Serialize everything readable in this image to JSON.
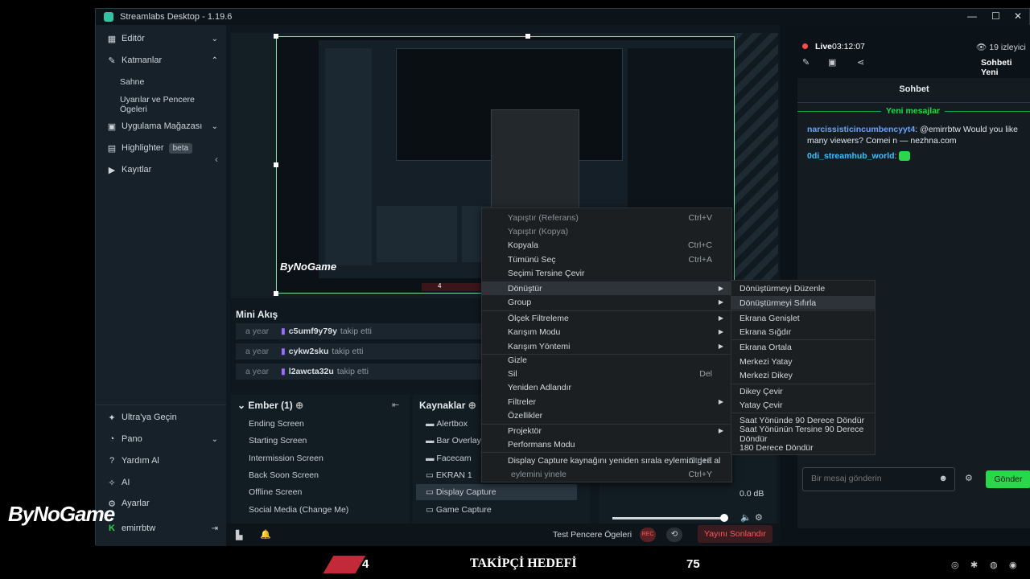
{
  "app": {
    "title": "Streamlabs Desktop - 1.19.6"
  },
  "sidebar": {
    "items": [
      {
        "label": "Editör"
      },
      {
        "label": "Katmanlar"
      },
      {
        "label": "Uygulama Mağazası"
      },
      {
        "label": "Highlighter",
        "badge": "beta"
      },
      {
        "label": "Kayıtlar"
      }
    ],
    "sub": [
      "Sahne",
      "Uyarılar ve Pencere Ögeleri"
    ],
    "bottom": [
      {
        "label": "Ultra'ya Geçin"
      },
      {
        "label": "Pano"
      },
      {
        "label": "Yardım Al"
      },
      {
        "label": "AI"
      },
      {
        "label": "Ayarlar"
      },
      {
        "label": "emirrbtw"
      }
    ]
  },
  "preview": {
    "watermark": "ByNoGame",
    "counter": "4"
  },
  "mini": {
    "title": "Mini Akış",
    "rows": [
      {
        "time": "a year",
        "user": "c5umf9y79y",
        "action": "takip etti"
      },
      {
        "time": "a year",
        "user": "cykw2sku",
        "action": "takip etti"
      },
      {
        "time": "a year",
        "user": "l2awcta32u",
        "action": "takip etti"
      }
    ]
  },
  "scenes": {
    "title": "Ember (1)",
    "items": [
      "Ending Screen",
      "Starting Screen",
      "Intermission Screen",
      "Back Soon Screen",
      "Offline Screen",
      "Social Media (Change Me)"
    ]
  },
  "sources": {
    "title": "Kaynaklar",
    "items": [
      "Alertbox",
      "Bar Overlay",
      "Facecam",
      "EKRAN 1",
      "Display Capture",
      "Game Capture"
    ]
  },
  "mixer": {
    "db": "0.0 dB"
  },
  "footer": {
    "test": "Test Pencere Ögeleri",
    "rec": "REC",
    "end": "Yayını Sonlandır"
  },
  "status": {
    "live": "Live",
    "time": "03:12:07",
    "viewers": "19 izleyici",
    "chat_tab": "Sohbeti Yeni"
  },
  "chat": {
    "title": "Sohbet",
    "new": "Yeni mesajlar",
    "msgs": [
      {
        "user": "narcissisticincumbencyyt4",
        "text": ": @emirrbtw Would you like many viewers? Comei n — nezhna.com"
      },
      {
        "user": "0di_streamhub_world",
        "text": ":"
      }
    ],
    "placeholder": "Bir mesaj gönderin",
    "send": "Gönder"
  },
  "menu": {
    "items": [
      {
        "label": "Yapıştır (Referans)",
        "sc": "Ctrl+V"
      },
      {
        "label": "Yapıştır (Kopya)",
        "sc": ""
      },
      {
        "label": "Kopyala",
        "sc": "Ctrl+C"
      },
      {
        "label": "Tümünü Seç",
        "sc": "Ctrl+A"
      },
      {
        "label": "Seçimi Tersine Çevir",
        "sc": ""
      },
      {
        "label": "Dönüştür"
      },
      {
        "label": "Group"
      },
      {
        "label": "Ölçek Filtreleme"
      },
      {
        "label": "Karışım Modu"
      },
      {
        "label": "Karışım Yöntemi"
      },
      {
        "label": "Gizle"
      },
      {
        "label": "Sil",
        "sc": "Del"
      },
      {
        "label": "Yeniden Adlandır"
      },
      {
        "label": "Filtreler"
      },
      {
        "label": "Özellikler"
      },
      {
        "label": "Projektör"
      },
      {
        "label": "Performans Modu"
      },
      {
        "label": "Display Capture kaynağını yeniden sırala eylemini geri al",
        "sc": "Ctrl+Z"
      },
      {
        "label": "eylemini yinele",
        "sc": "Ctrl+Y"
      }
    ],
    "sub": [
      "Dönüştürmeyi Düzenle",
      "Dönüştürmeyi Sıfırla",
      "Ekrana Genişlet",
      "Ekrana Sığdır",
      "Ekrana Ortala",
      "Merkezi Yatay",
      "Merkezi Dikey",
      "Dikey Çevir",
      "Yatay Çevir",
      "Saat Yönünde 90 Derece Döndür",
      "Saat Yönünün Tersine 90 Derece Döndür",
      "180 Derece Döndür"
    ]
  },
  "overlay": {
    "logo": "ByNoGame",
    "goal_current": "4",
    "goal_label": "TAKİPÇİ HEDEFİ",
    "goal_target": "75"
  },
  "colors": {
    "accent": "#31c3a2",
    "green": "#29d84a",
    "red": "#ff4b4b"
  }
}
